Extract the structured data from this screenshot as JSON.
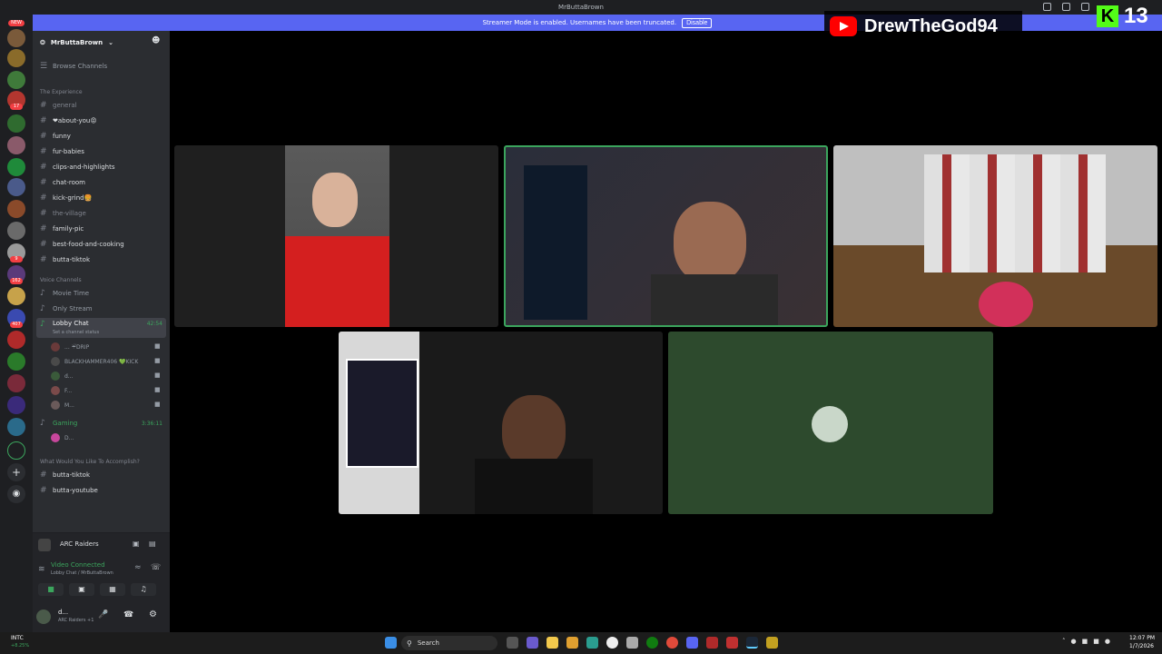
{
  "window": {
    "title": "MrButtaBrown"
  },
  "streamer_mode": {
    "message": "Streamer Mode is enabled. Usernames have been truncated.",
    "button": "Disable"
  },
  "guilds": {
    "new_badge": "NEW",
    "badges": [
      "17",
      "9",
      "162",
      "407"
    ]
  },
  "server": {
    "name": "MrButtaBrown",
    "browse": "Browse Channels"
  },
  "categories": {
    "experience": "The Experience",
    "voice": "Voice Channels",
    "accomplish": "What Would You Like To Accomplish?"
  },
  "text_channels": [
    {
      "name": "general",
      "dim": true
    },
    {
      "name": "❤about-you😡",
      "dim": false
    },
    {
      "name": "funny",
      "dim": false
    },
    {
      "name": "fur-babies",
      "dim": false
    },
    {
      "name": "clips-and-highlights",
      "dim": false
    },
    {
      "name": "chat-room",
      "dim": false
    },
    {
      "name": "kick-grind🍔",
      "dim": false
    },
    {
      "name": "the-village",
      "dim": true
    },
    {
      "name": "family-pic",
      "dim": false
    },
    {
      "name": "best-food-and-cooking",
      "dim": false
    },
    {
      "name": "butta-tiktok",
      "dim": false
    }
  ],
  "voice_channels": {
    "movie": "Movie Time",
    "only_stream": "Only Stream",
    "lobby": "Lobby Chat",
    "lobby_time": "42:54",
    "lobby_status": "Set a channel status",
    "members": [
      {
        "name": "... ☔DRIP"
      },
      {
        "name": "BLACKHAMMER406 💚KICK"
      },
      {
        "name": "d..."
      },
      {
        "name": "F..."
      },
      {
        "name": "M..."
      }
    ],
    "gaming": "Gaming",
    "gaming_time": "3:36:11",
    "gaming_member": "D..."
  },
  "extra_channels": [
    "butta-tiktok",
    "butta-youtube"
  ],
  "activity": {
    "game": "ARC Raiders"
  },
  "connection": {
    "status": "Video Connected",
    "detail": "Lobby Chat / MrButtaBrown"
  },
  "me": {
    "name": "d...",
    "status": "ARC Raiders +1"
  },
  "overlay": {
    "youtube_name": "DrewTheGod94",
    "kick_count": "13"
  },
  "taskbar": {
    "ticker": "INTC",
    "change": "+8.25%",
    "search": "Search",
    "time": "12:07 PM",
    "date": "1/7/2026"
  }
}
